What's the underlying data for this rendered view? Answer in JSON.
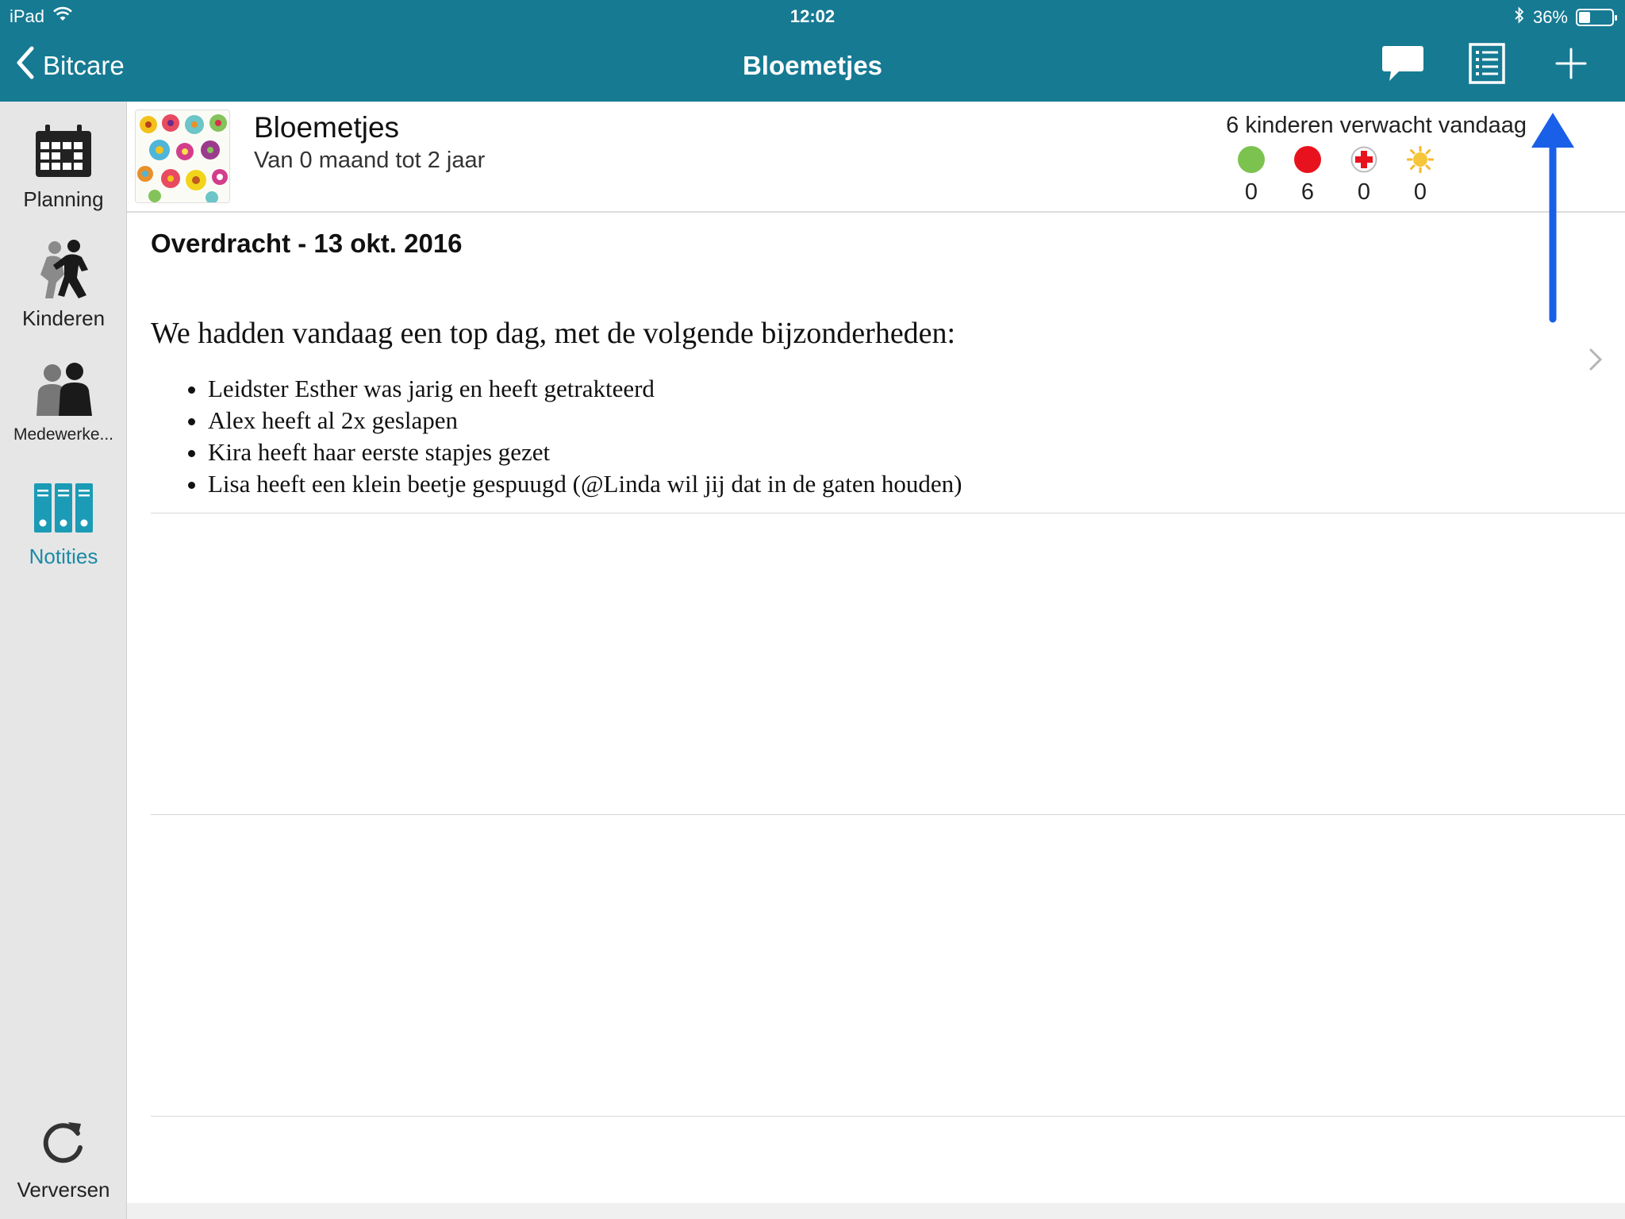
{
  "status_bar": {
    "device": "iPad",
    "time": "12:02",
    "battery": "36%",
    "battery_level": 0.36
  },
  "nav": {
    "back_label": "Bitcare",
    "title": "Bloemetjes",
    "icons": [
      "chat-icon",
      "list-icon",
      "plus-icon"
    ]
  },
  "sidebar": {
    "items": [
      {
        "label": "Planning",
        "icon": "calendar-icon"
      },
      {
        "label": "Kinderen",
        "icon": "children-icon"
      },
      {
        "label": "Medewerke...",
        "icon": "staff-icon"
      },
      {
        "label": "Notities",
        "icon": "binders-icon",
        "active": true
      }
    ],
    "refresh_label": "Verversen"
  },
  "group": {
    "name": "Bloemetjes",
    "subtitle": "Van 0 maand tot 2 jaar",
    "expected": "6 kinderen verwacht vandaag",
    "stats": [
      {
        "icon": "present-icon",
        "color": "#7cc24f",
        "value": "0"
      },
      {
        "icon": "absent-icon",
        "color": "#e8121e",
        "value": "6"
      },
      {
        "icon": "sick-icon",
        "color": "#e8121e",
        "value": "0"
      },
      {
        "icon": "vacation-icon",
        "color": "#f7b92a",
        "value": "0"
      }
    ]
  },
  "note": {
    "title": "Overdracht - 13 okt. 2016",
    "intro": "We hadden vandaag een top dag, met de volgende bijzonderheden:",
    "items": [
      "Leidster Esther was jarig en heeft getrakteerd",
      "Alex heeft al 2x geslapen",
      "Kira heeft haar eerste stapjes gezet",
      "Lisa heeft een klein beetje gespuugd (@Linda wil jij dat in de gaten houden)"
    ]
  },
  "colors": {
    "nav_bg": "#167a93",
    "accent": "#1b8aa5",
    "annotation_arrow": "#1a5fe8"
  }
}
